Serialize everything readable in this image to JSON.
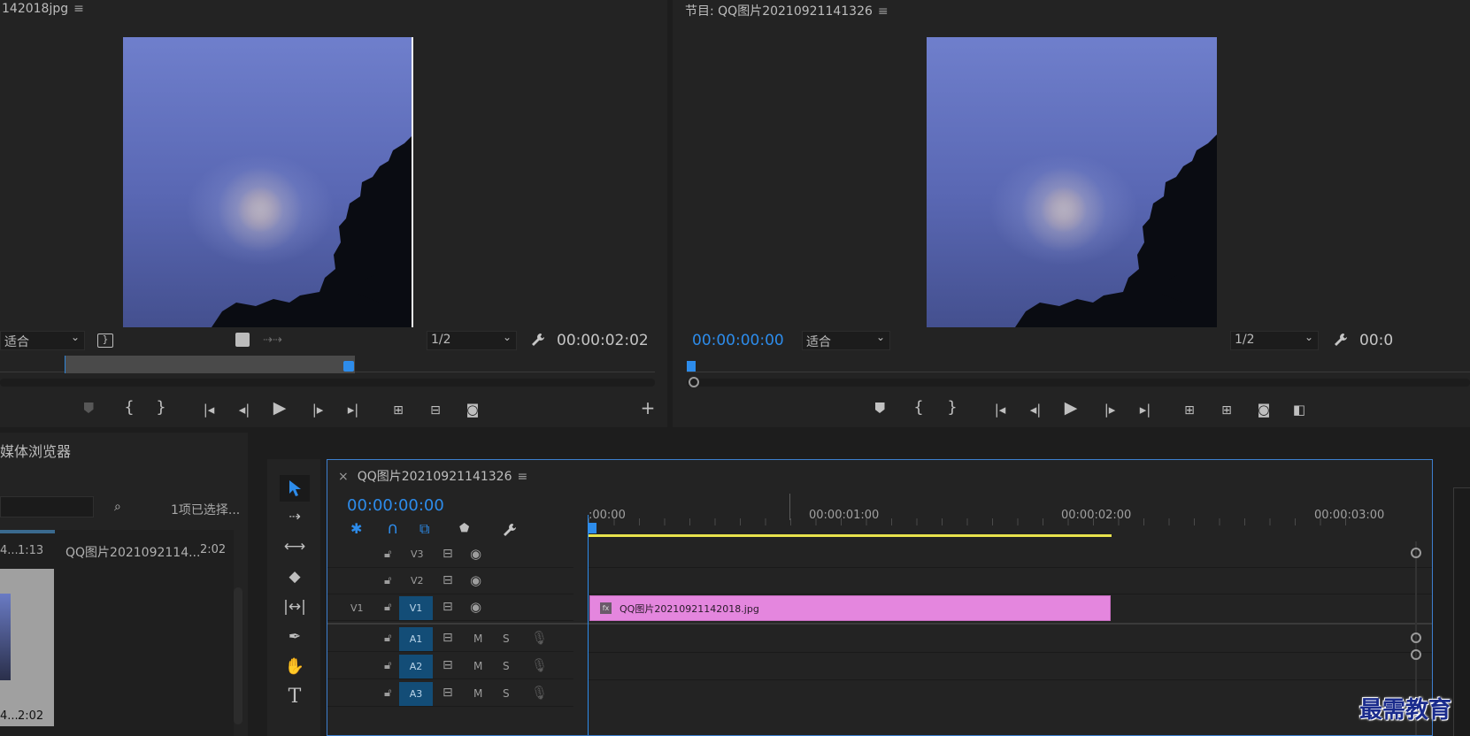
{
  "source_monitor": {
    "title": "142018jpg",
    "fit": "适合",
    "resolution": "1/2",
    "timecode": "00:00:02:02"
  },
  "program_monitor": {
    "title": "节目: QQ图片20210921141326",
    "timecode_left": "00:00:00:00",
    "fit": "适合",
    "resolution": "1/2",
    "timecode_right": "00:0"
  },
  "project": {
    "title": "媒体浏览器",
    "selection": "1项已选择...",
    "items": [
      {
        "name": "4...",
        "duration": "1:13"
      },
      {
        "name": "QQ图片2021092114...",
        "duration": "2:02"
      },
      {
        "name": "4...",
        "duration": "2:02"
      }
    ]
  },
  "timeline": {
    "close": "×",
    "title": "QQ图片20210921141326",
    "timecode": "00:00:00:00",
    "ruler": [
      ":00:00",
      "00:00:01:00",
      "00:00:02:00",
      "00:00:03:00"
    ],
    "video_tracks": [
      {
        "label": "V3",
        "src": ""
      },
      {
        "label": "V2",
        "src": ""
      },
      {
        "label": "V1",
        "src": "V1"
      }
    ],
    "audio_tracks": [
      {
        "label": "A1",
        "m": "M",
        "s": "S"
      },
      {
        "label": "A2",
        "m": "M",
        "s": "S"
      },
      {
        "label": "A3",
        "m": "M",
        "s": "S"
      }
    ],
    "clip": {
      "badge": "fx",
      "name": "QQ图片20210921142018.jpg",
      "color": "#e486de"
    }
  },
  "watermark": "最需教育",
  "colors": {
    "accent": "#2d8ceb",
    "clip": "#e486de",
    "track_target": "#134d77",
    "work_area": "#e8e24c"
  }
}
